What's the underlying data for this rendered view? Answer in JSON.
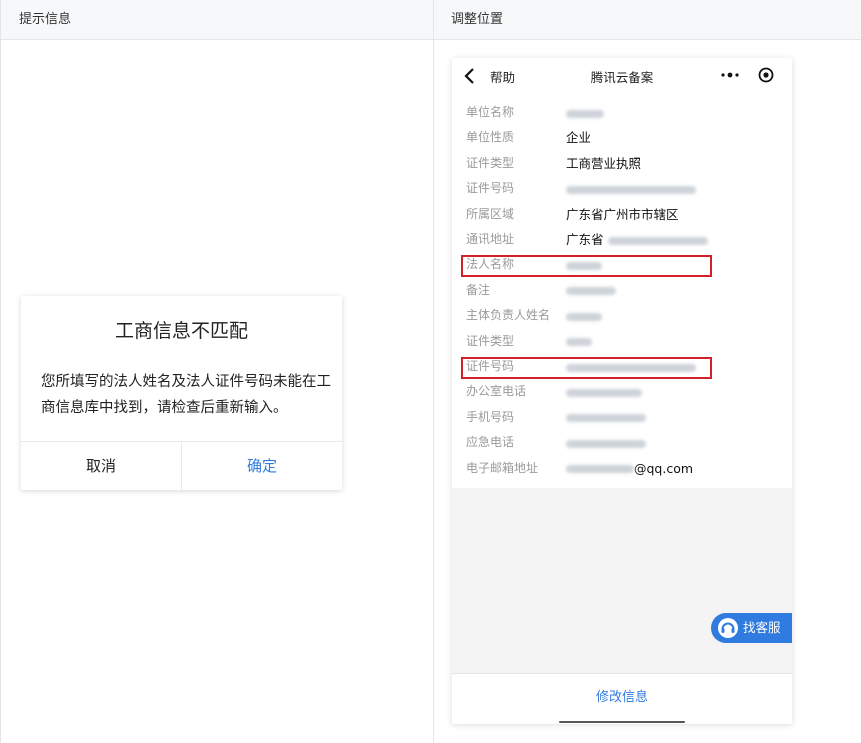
{
  "table": {
    "header_left": "提示信息",
    "header_right": "调整位置"
  },
  "dialog": {
    "title": "工商信息不匹配",
    "message": "您所填写的法人姓名及法人证件号码未能在工商信息库中找到，请检查后重新输入。",
    "cancel_label": "取消",
    "confirm_label": "确定"
  },
  "phone": {
    "nav": {
      "back_label": "帮助",
      "title": "腾讯云备案",
      "icons": [
        "chevron-left-icon",
        "more-icon",
        "target-icon"
      ]
    },
    "rows": [
      {
        "label": "单位名称",
        "value": ""
      },
      {
        "label": "单位性质",
        "value": "企业"
      },
      {
        "label": "证件类型",
        "value": "工商营业执照"
      },
      {
        "label": "证件号码",
        "value": ""
      },
      {
        "label": "所属区域",
        "value": "广东省广州市市辖区"
      },
      {
        "label": "通讯地址",
        "value": "广东省"
      },
      {
        "label": "法人名称",
        "value": ""
      },
      {
        "label": "备注",
        "value": ""
      },
      {
        "label": "主体负责人姓名",
        "value": ""
      },
      {
        "label": "证件类型",
        "value": ""
      },
      {
        "label": "证件号码",
        "value": ""
      },
      {
        "label": "办公室电话",
        "value": ""
      },
      {
        "label": "手机号码",
        "value": ""
      },
      {
        "label": "应急电话",
        "value": ""
      },
      {
        "label": "电子邮箱地址",
        "value": "@qq.com"
      }
    ],
    "highlight_color": "#d3212b",
    "customer_service_label": "找客服",
    "edit_button_label": "修改信息",
    "accent_color": "#2f7be0"
  }
}
